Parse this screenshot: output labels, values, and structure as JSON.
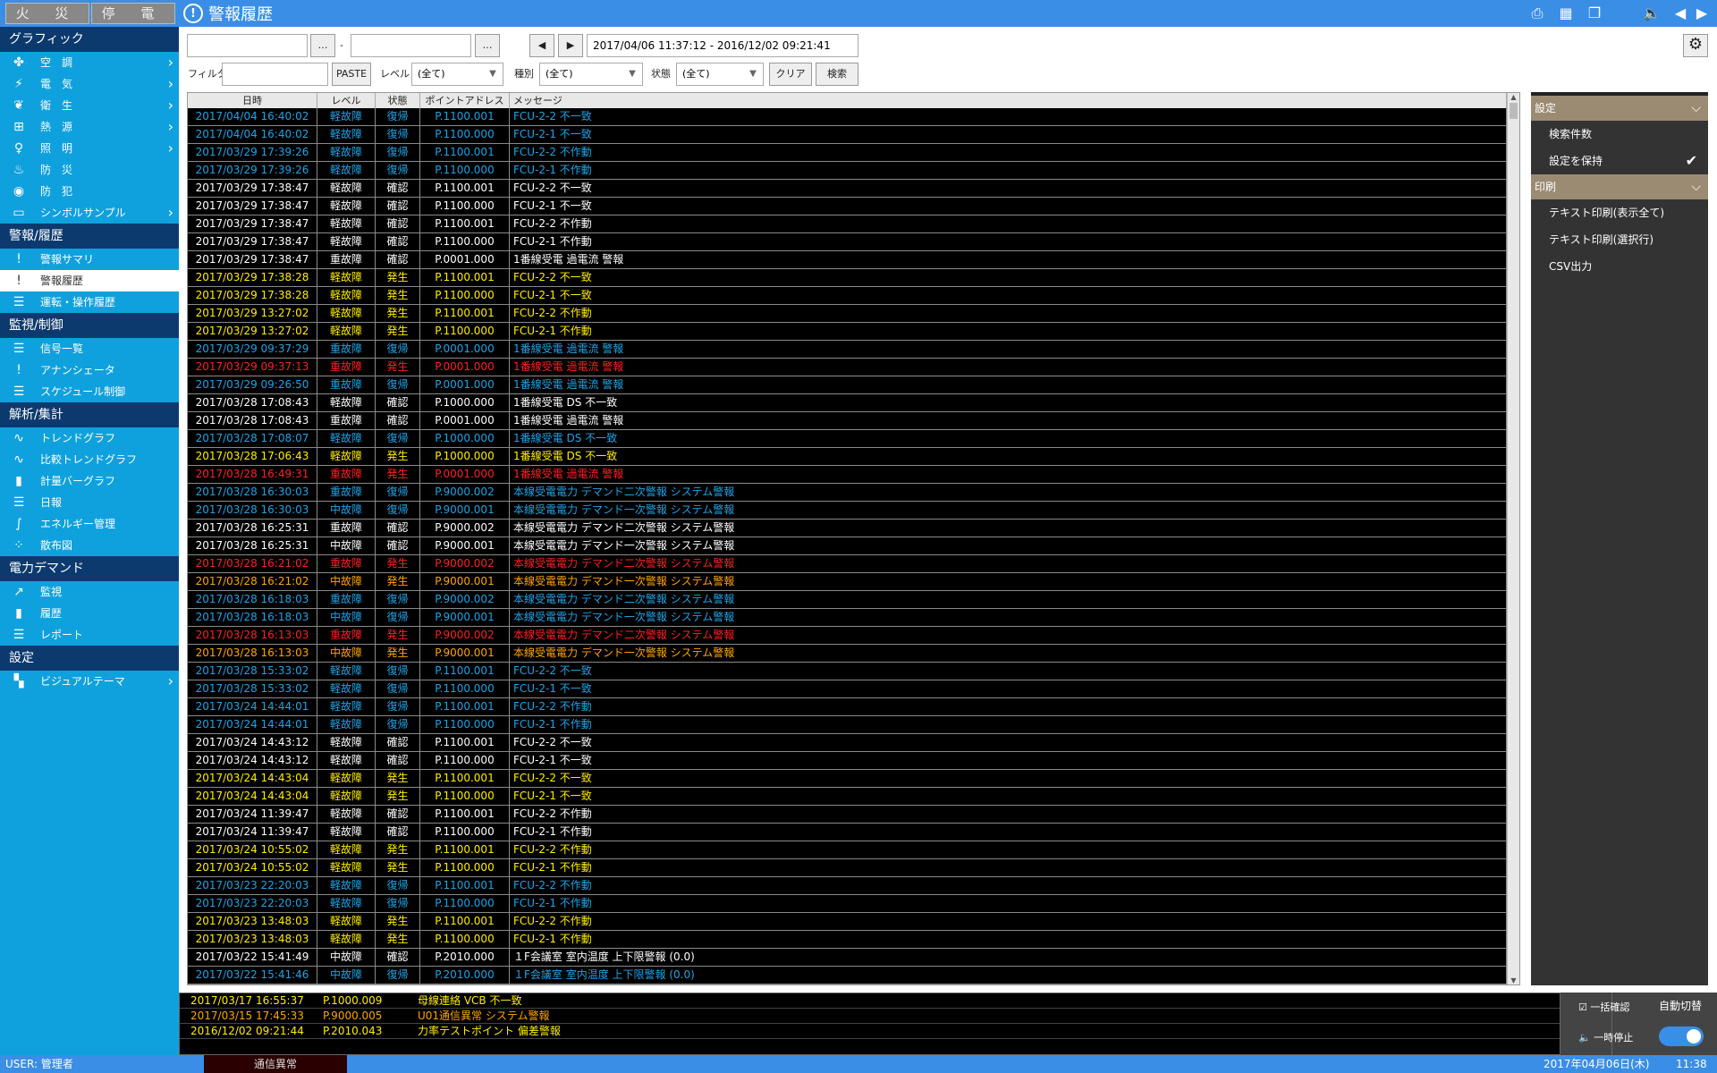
{
  "topbar": {
    "fire": "火 災",
    "power": "停 電",
    "title": "警報履歴"
  },
  "sidebar": {
    "graphic": "グラフィック",
    "graphic_items": [
      "空　調",
      "電　気",
      "衛　生",
      "熱　源",
      "照　明",
      "防　災",
      "防　犯",
      "シンボルサンプル"
    ],
    "alarm": "警報/履歴",
    "alarm_items": [
      "警報サマリ",
      "警報履歴",
      "運転・操作履歴"
    ],
    "monitor": "監視/制御",
    "monitor_items": [
      "信号一覧",
      "アナンシェータ",
      "スケジュール制御"
    ],
    "analysis": "解析/集計",
    "analysis_items": [
      "トレンドグラフ",
      "比較トレンドグラフ",
      "計量バーグラフ",
      "日報",
      "エネルギー管理",
      "散布図"
    ],
    "demand": "電力デマンド",
    "demand_items": [
      "監視",
      "履歴",
      "レポート"
    ],
    "settings": "設定",
    "settings_items": [
      "ビジュアルテーマ"
    ]
  },
  "toolbar": {
    "dots": "…",
    "dash": "-",
    "range": "2017/04/06 11:37:12 - 2016/12/02 09:21:41",
    "filter": "フィルタ",
    "paste": "PASTE",
    "level": "レベル",
    "level_val": "(全て)",
    "kind": "種別",
    "kind_val": "(全て)",
    "state": "状態",
    "state_val": "(全て)",
    "clear": "クリア",
    "search": "検索"
  },
  "grid": {
    "headers": [
      "日時",
      "レベル",
      "状態",
      "ポイントアドレス",
      "メッセージ"
    ],
    "colors": {
      "b": "#1fa3e6",
      "w": "#ffffff",
      "y": "#ffee00",
      "r": "#ff2020",
      "o": "#ffa500"
    },
    "rows": [
      [
        "2017/04/04 16:40:02",
        "軽故障",
        "復帰",
        "P.1100.001",
        "FCU-2-2 不一致",
        "b"
      ],
      [
        "2017/04/04 16:40:02",
        "軽故障",
        "復帰",
        "P.1100.000",
        "FCU-2-1 不一致",
        "b"
      ],
      [
        "2017/03/29 17:39:26",
        "軽故障",
        "復帰",
        "P.1100.001",
        "FCU-2-2 不作動",
        "b"
      ],
      [
        "2017/03/29 17:39:26",
        "軽故障",
        "復帰",
        "P.1100.000",
        "FCU-2-1 不作動",
        "b"
      ],
      [
        "2017/03/29 17:38:47",
        "軽故障",
        "確認",
        "P.1100.001",
        "FCU-2-2 不一致",
        "w"
      ],
      [
        "2017/03/29 17:38:47",
        "軽故障",
        "確認",
        "P.1100.000",
        "FCU-2-1 不一致",
        "w"
      ],
      [
        "2017/03/29 17:38:47",
        "軽故障",
        "確認",
        "P.1100.001",
        "FCU-2-2 不作動",
        "w"
      ],
      [
        "2017/03/29 17:38:47",
        "軽故障",
        "確認",
        "P.1100.000",
        "FCU-2-1 不作動",
        "w"
      ],
      [
        "2017/03/29 17:38:47",
        "重故障",
        "確認",
        "P.0001.000",
        "1番線受電 過電流 警報",
        "w"
      ],
      [
        "2017/03/29 17:38:28",
        "軽故障",
        "発生",
        "P.1100.001",
        "FCU-2-2 不一致",
        "y"
      ],
      [
        "2017/03/29 17:38:28",
        "軽故障",
        "発生",
        "P.1100.000",
        "FCU-2-1 不一致",
        "y"
      ],
      [
        "2017/03/29 13:27:02",
        "軽故障",
        "発生",
        "P.1100.001",
        "FCU-2-2 不作動",
        "y"
      ],
      [
        "2017/03/29 13:27:02",
        "軽故障",
        "発生",
        "P.1100.000",
        "FCU-2-1 不作動",
        "y"
      ],
      [
        "2017/03/29 09:37:29",
        "重故障",
        "復帰",
        "P.0001.000",
        "1番線受電 過電流 警報",
        "b"
      ],
      [
        "2017/03/29 09:37:13",
        "重故障",
        "発生",
        "P.0001.000",
        "1番線受電 過電流 警報",
        "r"
      ],
      [
        "2017/03/29 09:26:50",
        "重故障",
        "復帰",
        "P.0001.000",
        "1番線受電 過電流 警報",
        "b"
      ],
      [
        "2017/03/28 17:08:43",
        "軽故障",
        "確認",
        "P.1000.000",
        "1番線受電 DS 不一致",
        "w"
      ],
      [
        "2017/03/28 17:08:43",
        "重故障",
        "確認",
        "P.0001.000",
        "1番線受電 過電流 警報",
        "w"
      ],
      [
        "2017/03/28 17:08:07",
        "軽故障",
        "復帰",
        "P.1000.000",
        "1番線受電 DS 不一致",
        "b"
      ],
      [
        "2017/03/28 17:06:43",
        "軽故障",
        "発生",
        "P.1000.000",
        "1番線受電 DS 不一致",
        "y"
      ],
      [
        "2017/03/28 16:49:31",
        "重故障",
        "発生",
        "P.0001.000",
        "1番線受電 過電流 警報",
        "r"
      ],
      [
        "2017/03/28 16:30:03",
        "重故障",
        "復帰",
        "P.9000.002",
        "本線受電電力 デマンド二次警報 システム警報",
        "b"
      ],
      [
        "2017/03/28 16:30:03",
        "中故障",
        "復帰",
        "P.9000.001",
        "本線受電電力 デマンド一次警報 システム警報",
        "b"
      ],
      [
        "2017/03/28 16:25:31",
        "重故障",
        "確認",
        "P.9000.002",
        "本線受電電力 デマンド二次警報 システム警報",
        "w"
      ],
      [
        "2017/03/28 16:25:31",
        "中故障",
        "確認",
        "P.9000.001",
        "本線受電電力 デマンド一次警報 システム警報",
        "w"
      ],
      [
        "2017/03/28 16:21:02",
        "重故障",
        "発生",
        "P.9000.002",
        "本線受電電力 デマンド二次警報 システム警報",
        "r"
      ],
      [
        "2017/03/28 16:21:02",
        "中故障",
        "発生",
        "P.9000.001",
        "本線受電電力 デマンド一次警報 システム警報",
        "o"
      ],
      [
        "2017/03/28 16:18:03",
        "重故障",
        "復帰",
        "P.9000.002",
        "本線受電電力 デマンド二次警報 システム警報",
        "b"
      ],
      [
        "2017/03/28 16:18:03",
        "中故障",
        "復帰",
        "P.9000.001",
        "本線受電電力 デマンド一次警報 システム警報",
        "b"
      ],
      [
        "2017/03/28 16:13:03",
        "重故障",
        "発生",
        "P.9000.002",
        "本線受電電力 デマンド二次警報 システム警報",
        "r"
      ],
      [
        "2017/03/28 16:13:03",
        "中故障",
        "発生",
        "P.9000.001",
        "本線受電電力 デマンド一次警報 システム警報",
        "o"
      ],
      [
        "2017/03/28 15:33:02",
        "軽故障",
        "復帰",
        "P.1100.001",
        "FCU-2-2 不一致",
        "b"
      ],
      [
        "2017/03/28 15:33:02",
        "軽故障",
        "復帰",
        "P.1100.000",
        "FCU-2-1 不一致",
        "b"
      ],
      [
        "2017/03/24 14:44:01",
        "軽故障",
        "復帰",
        "P.1100.001",
        "FCU-2-2 不作動",
        "b"
      ],
      [
        "2017/03/24 14:44:01",
        "軽故障",
        "復帰",
        "P.1100.000",
        "FCU-2-1 不作動",
        "b"
      ],
      [
        "2017/03/24 14:43:12",
        "軽故障",
        "確認",
        "P.1100.001",
        "FCU-2-2 不一致",
        "w"
      ],
      [
        "2017/03/24 14:43:12",
        "軽故障",
        "確認",
        "P.1100.000",
        "FCU-2-1 不一致",
        "w"
      ],
      [
        "2017/03/24 14:43:04",
        "軽故障",
        "発生",
        "P.1100.001",
        "FCU-2-2 不一致",
        "y"
      ],
      [
        "2017/03/24 14:43:04",
        "軽故障",
        "発生",
        "P.1100.000",
        "FCU-2-1 不一致",
        "y"
      ],
      [
        "2017/03/24 11:39:47",
        "軽故障",
        "確認",
        "P.1100.001",
        "FCU-2-2 不作動",
        "w"
      ],
      [
        "2017/03/24 11:39:47",
        "軽故障",
        "確認",
        "P.1100.000",
        "FCU-2-1 不作動",
        "w"
      ],
      [
        "2017/03/24 10:55:02",
        "軽故障",
        "発生",
        "P.1100.001",
        "FCU-2-2 不作動",
        "y"
      ],
      [
        "2017/03/24 10:55:02",
        "軽故障",
        "発生",
        "P.1100.000",
        "FCU-2-1 不作動",
        "y"
      ],
      [
        "2017/03/23 22:20:03",
        "軽故障",
        "復帰",
        "P.1100.001",
        "FCU-2-2 不作動",
        "b"
      ],
      [
        "2017/03/23 22:20:03",
        "軽故障",
        "復帰",
        "P.1100.000",
        "FCU-2-1 不作動",
        "b"
      ],
      [
        "2017/03/23 13:48:03",
        "軽故障",
        "発生",
        "P.1100.001",
        "FCU-2-2 不作動",
        "y"
      ],
      [
        "2017/03/23 13:48:03",
        "軽故障",
        "発生",
        "P.1100.000",
        "FCU-2-1 不作動",
        "y"
      ],
      [
        "2017/03/22 15:41:49",
        "中故障",
        "確認",
        "P.2010.000",
        "１F会議室 室内温度 上下限警報 (0.0)",
        "w"
      ],
      [
        "2017/03/22 15:41:46",
        "中故障",
        "復帰",
        "P.2010.000",
        "１F会議室 室内温度 上下限警報 (0.0)",
        "b"
      ]
    ]
  },
  "rpanel": {
    "settings": "設定",
    "count": "検索件数",
    "keep": "設定を保持",
    "print": "印刷",
    "print_all": "テキスト印刷(表示全て)",
    "print_sel": "テキスト印刷(選択行)",
    "csv": "CSV出力"
  },
  "bottom": {
    "alarms": [
      [
        "2017/03/17 16:55:37",
        "P.1000.009",
        "母線連絡 VCB 不一致",
        "y"
      ],
      [
        "2017/03/15 17:45:33",
        "P.9000.005",
        "U01通信異常 システム警報",
        "o"
      ],
      [
        "2016/12/02 09:21:44",
        "P.2010.043",
        "力率テストポイント 偏差警報",
        "y"
      ]
    ],
    "bulk": "一括確認",
    "pause": "一時停止",
    "auto": "自動切替"
  },
  "status": {
    "user": "USER: 管理者",
    "comm": "通信異常",
    "date": "2017年04月06日(木)",
    "time": "11:38"
  }
}
